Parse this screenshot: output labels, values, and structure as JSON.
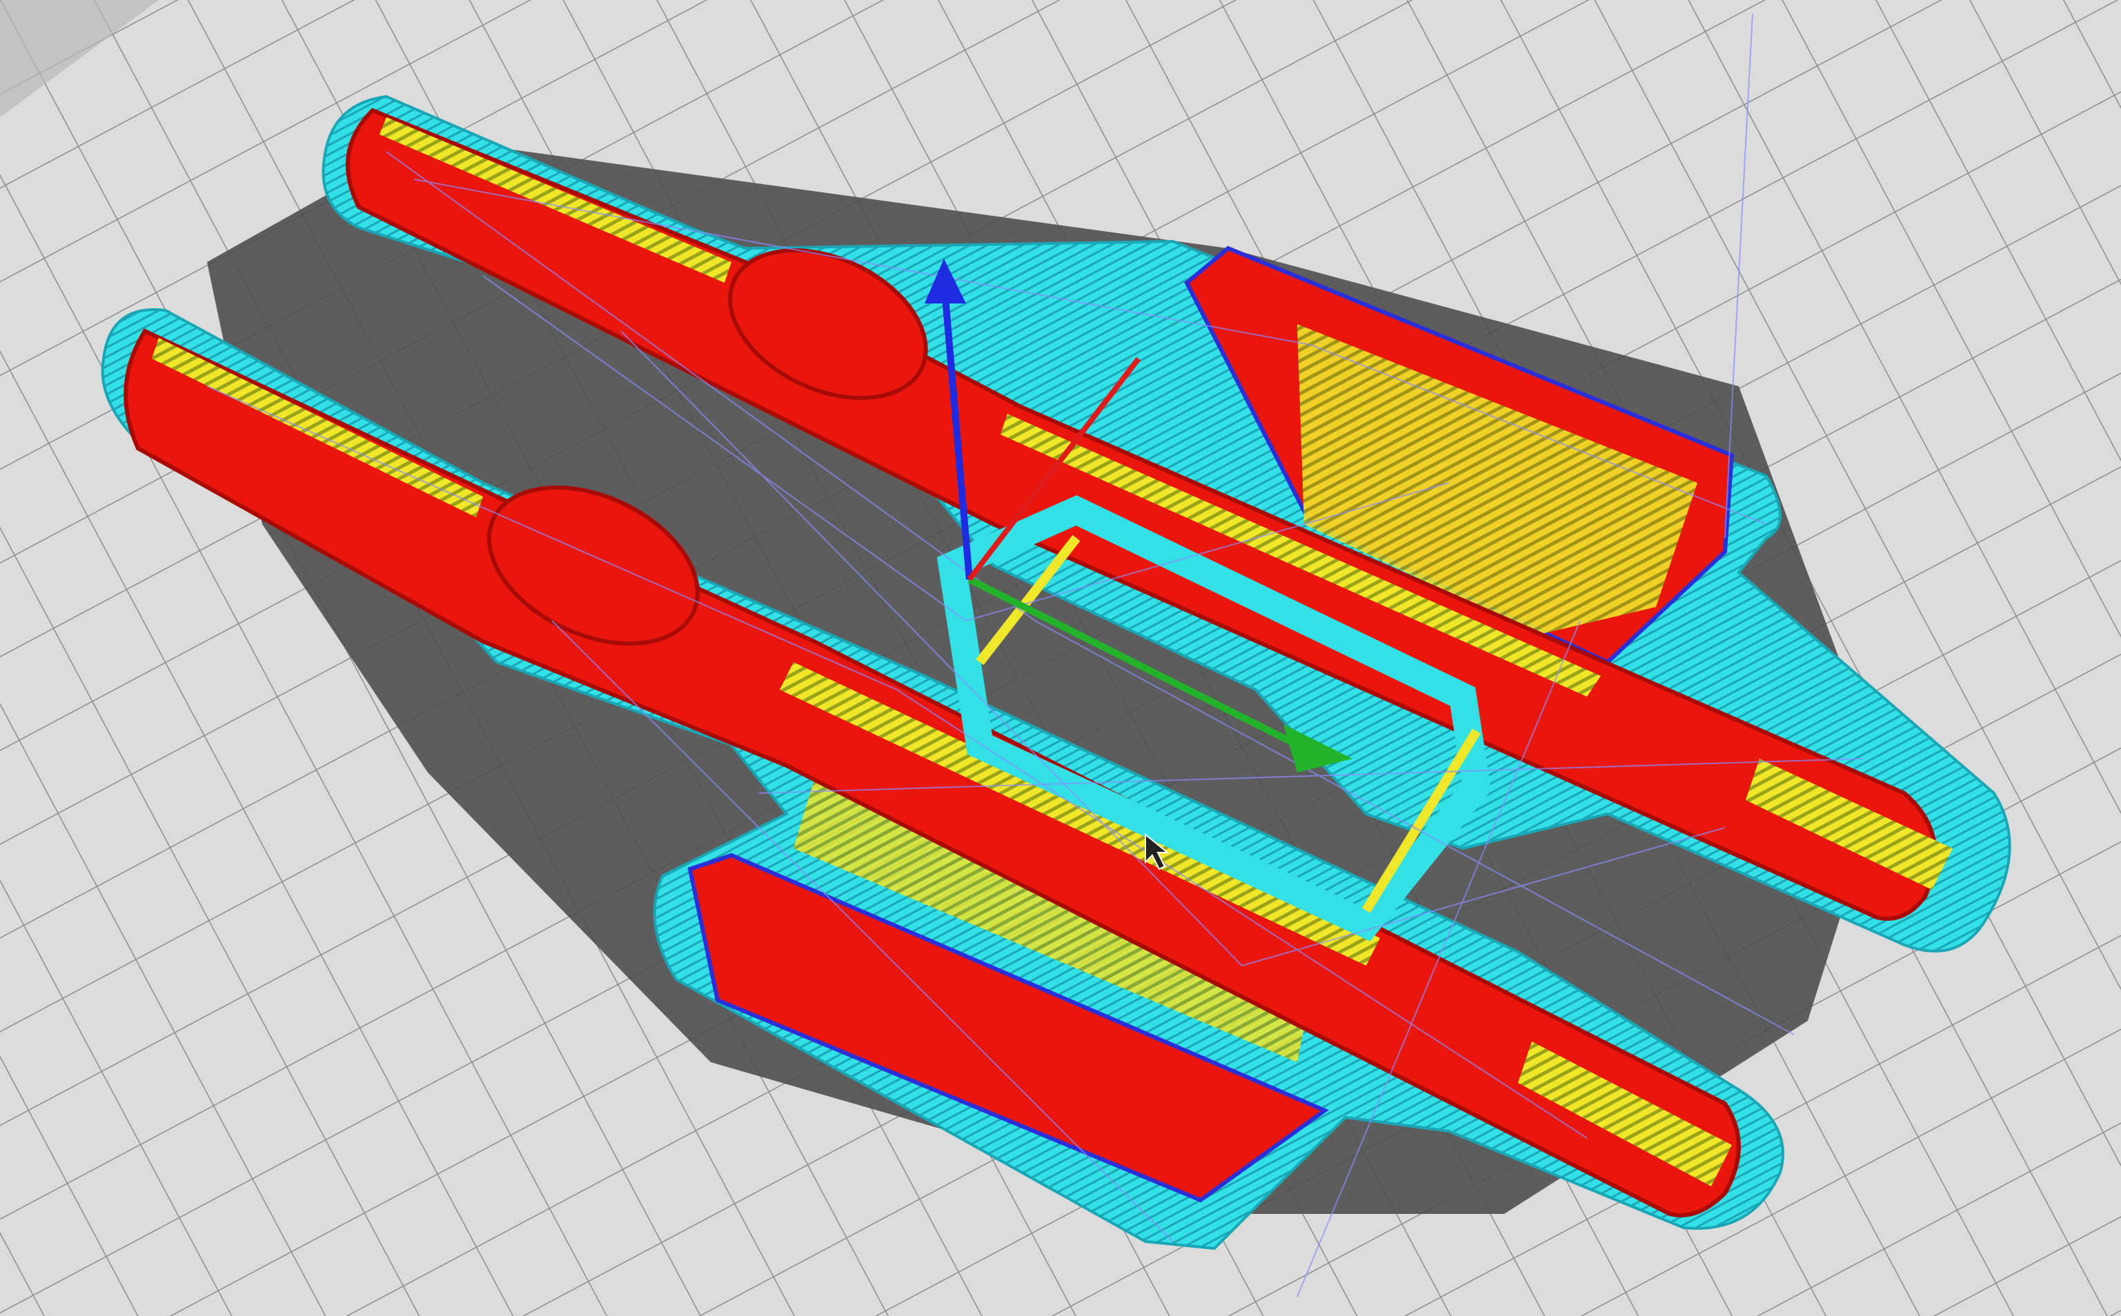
{
  "viewport": {
    "view": "3d-layer-preview",
    "colors": {
      "bed_background": "#dcdcdc",
      "bed_grid": "#8d8d8d",
      "bed_corner_border": "#b8b8b8",
      "shadow": "#4b4b4b",
      "skirt_brim": "#33e0e6",
      "skirt_brim_dark": "#1aa6b4",
      "part_body": "#e8160d",
      "part_body_dark": "#a80b06",
      "outer_wall": "#2b2fd9",
      "inner_wall": "#28c43a",
      "top_skin": "#f0e62a",
      "travel_lines": "#8c8cff",
      "gizmo_x": "#e11b1b",
      "gizmo_y": "#22b32a",
      "gizmo_z": "#1f2be0"
    },
    "icons": [
      "axis-gizmo",
      "mouse-cursor-icon"
    ]
  }
}
